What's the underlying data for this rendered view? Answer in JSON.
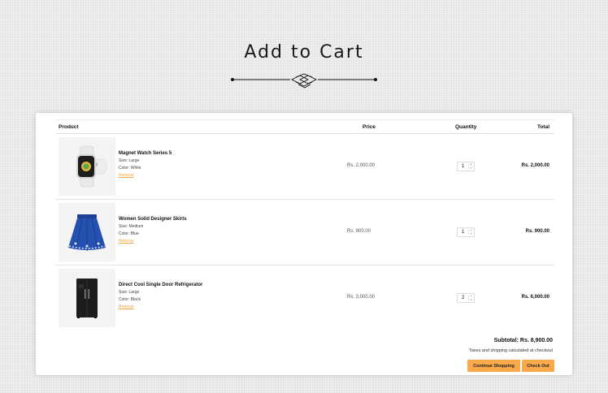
{
  "page": {
    "title": "Add to Cart"
  },
  "table": {
    "headers": {
      "product": "Product",
      "price": "Price",
      "quantity": "Quantity",
      "total": "Total"
    }
  },
  "items": [
    {
      "name": "Magnet Watch Series 5",
      "size": "Size: Large",
      "color": "Color: White",
      "remove": "Remove",
      "price": "Rs. 2,000.00",
      "quantity": "1",
      "total": "Rs. 2,000.00",
      "icon": "smartwatch-image"
    },
    {
      "name": "Women Solid Designer Skirts",
      "size": "Size: Medium",
      "color": "Color: Blue",
      "remove": "Remove",
      "price": "Rs. 900.00",
      "quantity": "1",
      "total": "Rs. 900.00",
      "icon": "skirt-image"
    },
    {
      "name": "Direct Cool Single Door Refrigerator",
      "size": "Size: Large",
      "color": "Color: Black",
      "remove": "Remove",
      "price": "Rs. 3,000.00",
      "quantity": "2",
      "total": "Rs. 6,000.00",
      "icon": "refrigerator-image"
    }
  ],
  "summary": {
    "subtotal": "Subtotal: Rs. 8,900.00",
    "tax_note": "Taxes and shipping calculated at checkout"
  },
  "actions": {
    "continue": "Continue Shopping",
    "checkout": "Check Out"
  },
  "colors": {
    "accent": "#f9a84a",
    "remove_link": "#f4a43c"
  }
}
